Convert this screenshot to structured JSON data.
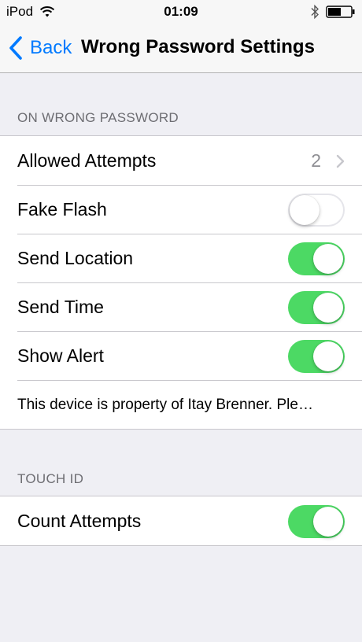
{
  "status_bar": {
    "carrier": "iPod",
    "time": "01:09",
    "icons": [
      "wifi-icon",
      "bluetooth-icon",
      "battery-icon"
    ]
  },
  "nav": {
    "back_label": "Back",
    "title": "Wrong Password Settings"
  },
  "sections": {
    "wrong_password": {
      "header": "ON WRONG PASSWORD",
      "allowed_attempts": {
        "label": "Allowed Attempts",
        "value": "2"
      },
      "fake_flash": {
        "label": "Fake Flash",
        "on": false
      },
      "send_location": {
        "label": "Send Location",
        "on": true
      },
      "send_time": {
        "label": "Send Time",
        "on": true
      },
      "show_alert": {
        "label": "Show Alert",
        "on": true
      },
      "alert_message": "This device is property of Itay Brenner. Ple…"
    },
    "touch_id": {
      "header": "TOUCH ID",
      "count_attempts": {
        "label": "Count Attempts",
        "on": true
      }
    }
  },
  "colors": {
    "accent": "#007aff",
    "switch_on": "#4cd964",
    "background": "#efeff4"
  }
}
